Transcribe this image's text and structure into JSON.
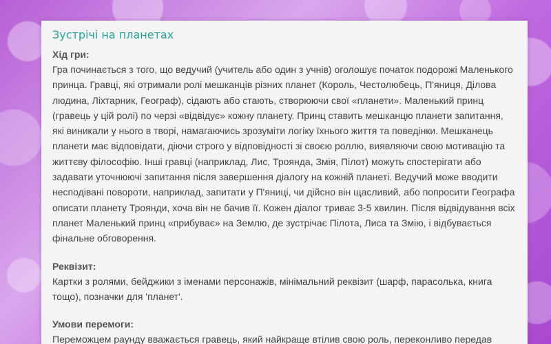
{
  "page": {
    "title": "Зустрічі на планетах",
    "sections": [
      {
        "heading": "Хід гри:",
        "text": "Гра починається з того, що ведучий (учитель або один з учнів) оголошує початок подорожі Маленького принца. Гравці, які отримали ролі мешканців різних планет (Король, Честолюбець, П'яниця, Ділова людина, Ліхтарник, Географ), сідають або стають, створюючи свої «планети». Маленький принц (гравець у цій ролі) по черзі «відвідує» кожну планету. Принц ставить мешканцю планети запитання, які виникали у нього в творі, намагаючись зрозуміти логіку їхнього життя та поведінки. Мешканець планети має відповідати, діючи строго у відповідності зі своєю роллю, виявляючи свою мотивацію та життєву філософію. Інші гравці (наприклад, Лис, Троянда, Змія, Пілот) можуть спостерігати або задавати уточнюючі запитання після завершення діалогу на кожній планеті. Ведучий може вводити несподівані повороти, наприклад, запитати у П'яниці, чи дійсно він щасливий, або попросити Географа описати планету Троянди, хоча він не бачив її. Кожен діалог триває 3-5 хвилин. Після відвідування всіх планет Маленький принц «прибуває» на Землю, де зустрічає Пілота, Лиса та Змію, і відбувається фінальне обговорення."
      },
      {
        "heading": "Реквізит:",
        "text": "Картки з ролями, бейджики з іменами персонажів, мінімальний реквізит (шарф, парасолька, книга тощо), позначки для 'планет'."
      },
      {
        "heading": "Умови перемоги:",
        "text": "Переможцем раунду вважається гравець, який найкраще втілив свою роль, переконливо передав"
      }
    ]
  }
}
